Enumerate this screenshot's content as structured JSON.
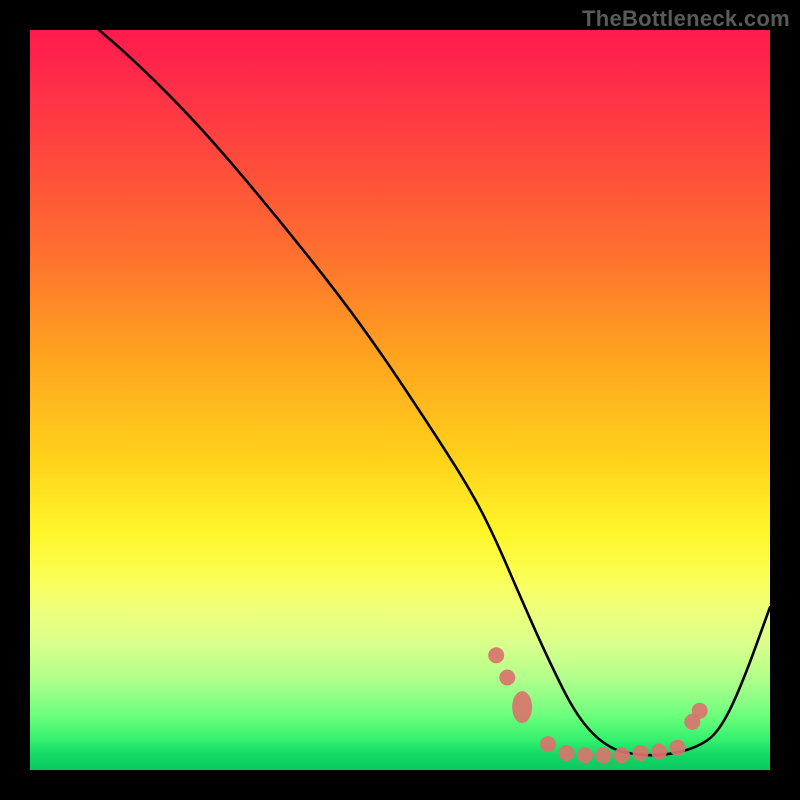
{
  "watermark": "TheBottleneck.com",
  "chart_data": {
    "type": "line",
    "title": "",
    "xlabel": "",
    "ylabel": "",
    "xlim": [
      0,
      100
    ],
    "ylim": [
      0,
      100
    ],
    "series": [
      {
        "name": "bottleneck-curve",
        "x": [
          0,
          7,
          14,
          23,
          34,
          45,
          55,
          60,
          63,
          66,
          70,
          74,
          78,
          82,
          86,
          90,
          93,
          96,
          100
        ],
        "y": [
          108,
          102,
          96,
          87,
          74,
          60,
          45,
          37,
          31,
          24,
          15,
          7,
          3,
          2,
          2,
          3,
          5,
          11,
          22
        ]
      }
    ],
    "markers": [
      {
        "x": 63.0,
        "y": 15.5,
        "shape": "circle"
      },
      {
        "x": 64.5,
        "y": 12.5,
        "shape": "circle"
      },
      {
        "x": 66.5,
        "y": 8.5,
        "shape": "oval"
      },
      {
        "x": 70.0,
        "y": 3.5,
        "shape": "circle"
      },
      {
        "x": 72.5,
        "y": 2.3,
        "shape": "circle"
      },
      {
        "x": 75.0,
        "y": 2.0,
        "shape": "circle"
      },
      {
        "x": 77.5,
        "y": 2.0,
        "shape": "circle"
      },
      {
        "x": 80.0,
        "y": 2.0,
        "shape": "circle"
      },
      {
        "x": 82.5,
        "y": 2.3,
        "shape": "circle"
      },
      {
        "x": 85.0,
        "y": 2.5,
        "shape": "circle"
      },
      {
        "x": 87.5,
        "y": 3.0,
        "shape": "circle"
      },
      {
        "x": 89.5,
        "y": 6.5,
        "shape": "circle"
      },
      {
        "x": 90.5,
        "y": 8.0,
        "shape": "circle"
      }
    ],
    "marker_color": "#d9746c",
    "curve_color": "#000000",
    "gradient_stops": [
      {
        "pos": 0,
        "color": "#ff1a4d"
      },
      {
        "pos": 100,
        "color": "#0bc95f"
      }
    ]
  }
}
